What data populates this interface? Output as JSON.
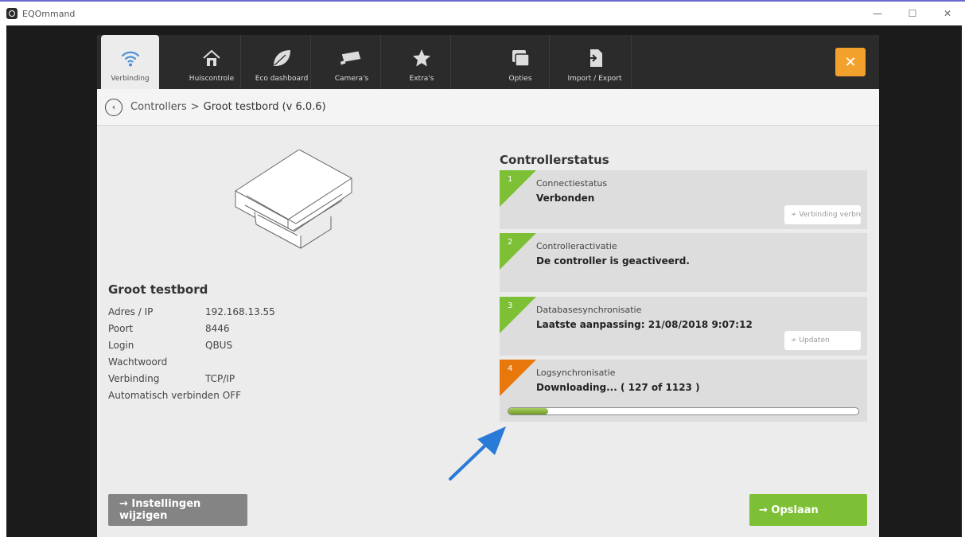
{
  "window": {
    "title": "EQOmmand",
    "minimize": "—",
    "maximize": "☐",
    "close": "✕"
  },
  "nav": {
    "tabs": [
      {
        "label": "Verbinding",
        "icon": "wifi-icon",
        "active": true
      },
      {
        "label": "Huiscontrole",
        "icon": "house-icon"
      },
      {
        "label": "Eco dashboard",
        "icon": "leaf-icon"
      },
      {
        "label": "Camera's",
        "icon": "camera-icon"
      },
      {
        "label": "Extra's",
        "icon": "star-icon"
      },
      {
        "label": "Opties",
        "icon": "windows-icon"
      },
      {
        "label": "Import / Export",
        "icon": "import-export-icon"
      }
    ],
    "close": "✕"
  },
  "breadcrumb": {
    "back": "‹",
    "parent": "Controllers",
    "sep": ">",
    "current": "Groot testbord (v 6.0.6)"
  },
  "controller": {
    "name": "Groot testbord",
    "props": [
      {
        "k": "Adres / IP",
        "v": "192.168.13.55"
      },
      {
        "k": "Poort",
        "v": "8446"
      },
      {
        "k": "Login",
        "v": "QBUS"
      },
      {
        "k": "Wachtwoord",
        "v": ""
      },
      {
        "k": "Verbinding",
        "v": "TCP/IP"
      },
      {
        "k": "Automatisch verbinden",
        "v": "OFF"
      }
    ]
  },
  "status": {
    "title": "Controllerstatus",
    "steps": [
      {
        "num": "1",
        "label": "Connectiestatus",
        "value": "Verbonden",
        "action": "≁ Verbinding verbreken"
      },
      {
        "num": "2",
        "label": "Controlleractivatie",
        "value": "De controller is geactiveerd."
      },
      {
        "num": "3",
        "label": "Databasesynchronisatie",
        "value": "Laatste aanpassing: 21/08/2018 9:07:12",
        "action": "≁ Updaten"
      },
      {
        "num": "4",
        "label": "Logsynchronisatie",
        "value": "Downloading... ( 127 of 1123 )",
        "progress": 0.113
      }
    ]
  },
  "buttons": {
    "settings": "→  Instellingen wijzigen",
    "save": "→  Opslaan"
  },
  "colors": {
    "green": "#7dc035",
    "orange": "#e8780b",
    "accent": "#f2a22c",
    "blue_arrow": "#2a7ad8"
  }
}
